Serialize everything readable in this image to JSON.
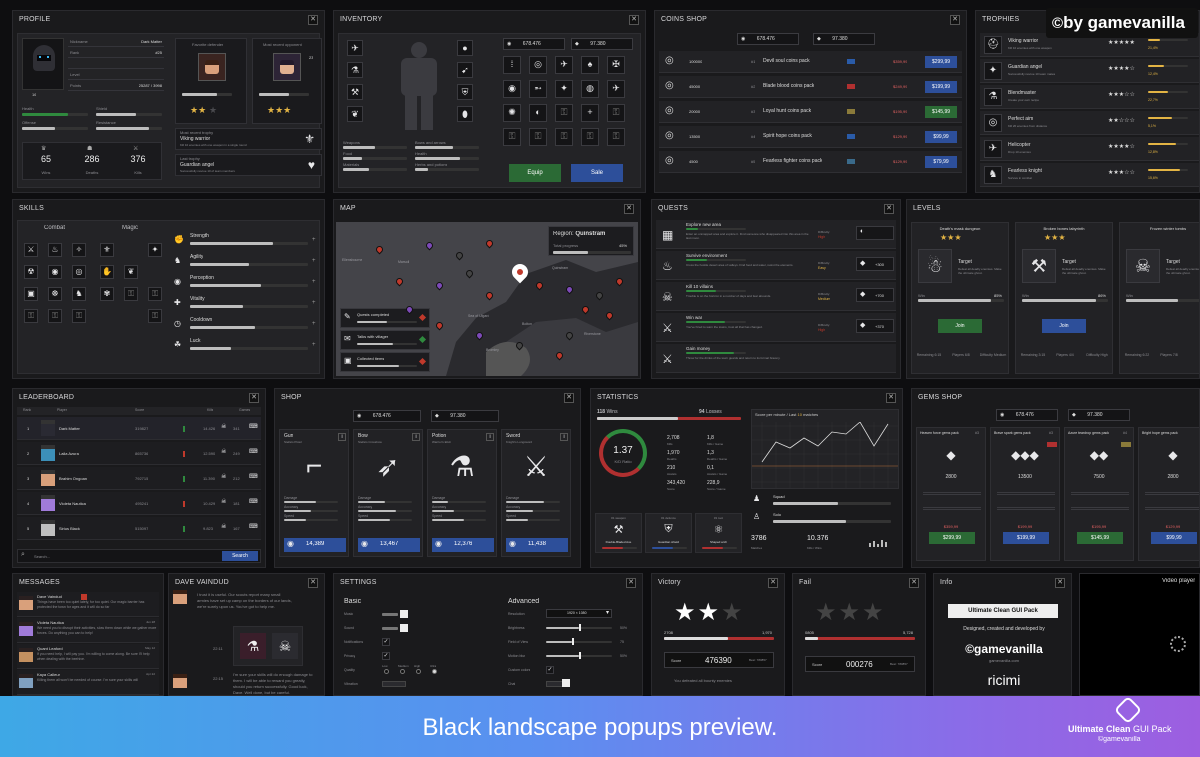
{
  "watermark": "by gamevanilla",
  "banner": {
    "caption": "Black landscape popups preview.",
    "pack_title_a": "Ultimate Clean",
    "pack_title_b": "GUI Pack",
    "copyright": "©gamevanilla"
  },
  "profile": {
    "title": "PROFILE",
    "fields": [
      {
        "k": "Nickname",
        "v": "Dark Matter"
      },
      {
        "k": "Rank",
        "v": "#25"
      },
      {
        "k": "",
        "v": ""
      },
      {
        "k": "Level",
        "v": ""
      },
      {
        "k": "Points",
        "v": "25287 / 3998"
      }
    ],
    "level_badge": "16",
    "stats": [
      {
        "k": "Health"
      },
      {
        "k": "Shield"
      },
      {
        "k": "Offense"
      },
      {
        "k": "Resistance"
      }
    ],
    "counters": [
      {
        "v": "65",
        "k": "Wins"
      },
      {
        "v": "286",
        "k": "Deaths"
      },
      {
        "v": "376",
        "k": "Kills"
      }
    ],
    "fav_label": "Favorite defender",
    "recent_label": "Most recent opponent",
    "recent_level": "23",
    "badges": [
      {
        "sub": "Most recent trophy",
        "name": "Viking warrior",
        "desc": "Kill 10 enemies with one weapon in a single round"
      },
      {
        "sub": "Last trophy",
        "name": "Guardian angel",
        "desc": "Successfully rescue 10 of team members"
      }
    ]
  },
  "inventory": {
    "title": "INVENTORY",
    "coins": "678.476",
    "gems": "97.380",
    "stats": [
      {
        "k": "Weapons"
      },
      {
        "k": "Bows and arrows"
      },
      {
        "k": "Food"
      },
      {
        "k": "Health"
      },
      {
        "k": "Materials"
      },
      {
        "k": "Herbs and potions"
      }
    ],
    "equip": "Equip",
    "sale": "Sale"
  },
  "coins_shop": {
    "title": "COINS SHOP",
    "coins": "678.476",
    "gems": "97.380",
    "items": [
      {
        "qty": "100000",
        "rank": "#1",
        "name": "Devil soul coins pack",
        "tag": "",
        "old": "$359,99",
        "price": "$299,99"
      },
      {
        "qty": "45000",
        "rank": "#2",
        "name": "Blade blood coins pack",
        "tag": "",
        "old": "$249,99",
        "price": "$199,99"
      },
      {
        "qty": "20000",
        "rank": "#3",
        "name": "Loyal hunt coins pack",
        "tag": "",
        "old": "$195,99",
        "price": "$145,99"
      },
      {
        "qty": "13500",
        "rank": "#4",
        "name": "Spirit hope coins pack",
        "tag": "",
        "old": "$129,99",
        "price": "$99,99"
      },
      {
        "qty": "4500",
        "rank": "#5",
        "name": "Fearless fighter coins pack",
        "tag": "",
        "old": "$129,99",
        "price": "$79,99"
      }
    ]
  },
  "trophies": {
    "title": "TROPHIES",
    "items": [
      {
        "name": "Viking warrior",
        "desc": "Kill 10 enemies with one weapon",
        "pct": "21,4%"
      },
      {
        "name": "Guardian angel",
        "desc": "Successfully rescue 10 team mates",
        "pct": "12,4%"
      },
      {
        "name": "Blendmaster",
        "desc": "Create your own recipe",
        "pct": "22,7%"
      },
      {
        "name": "Perfect aim",
        "desc": "Kill 20 enemies from distance",
        "pct": "5,1%"
      },
      {
        "name": "Helicopter",
        "desc": "Drop 10 enemies",
        "pct": "12,8%"
      },
      {
        "name": "Fearless knight",
        "desc": "Survive in combat",
        "pct": "15,6%"
      }
    ]
  },
  "skills": {
    "title": "SKILLS",
    "combat": "Combat",
    "magic": "Magic",
    "bars": [
      {
        "k": "Strength"
      },
      {
        "k": "Agility"
      },
      {
        "k": "Perception"
      },
      {
        "k": "Vitality"
      },
      {
        "k": "Cooldown"
      },
      {
        "k": "Luck"
      }
    ]
  },
  "map": {
    "title": "MAP",
    "region_label": "Region:",
    "region": "Quinstram",
    "progress_label": "Total progress",
    "progress": "45%",
    "places": [
      "Ellensbourne",
      "Marsoll",
      "Quinstram",
      "Bolton",
      "Sea of Ulgard",
      "Bromley",
      "Riverstone"
    ],
    "quests": [
      "Quests completed",
      "Talks with villager",
      "Collected items"
    ]
  },
  "quests": {
    "title": "QUESTS",
    "items": [
      {
        "name": "Explore new area",
        "desc": "Enter an unmapped area and explore it. Find someone who disappeared into this area in the last moon.",
        "diff": "Difficulty:",
        "level": "High",
        "reward": ""
      },
      {
        "name": "Survive environment",
        "desc": "Cross the hostile desert area of valleys. Find food and water, resist the elements.",
        "diff": "Difficulty:",
        "level": "Easy",
        "reward": "+300"
      },
      {
        "name": "Kill 10 villains",
        "desc": "Trouble is on the horizon in a number of days and fear abounds.",
        "diff": "Difficulty:",
        "level": "Medium",
        "reward": "+700"
      },
      {
        "name": "Win war",
        "desc": "You've hired to warn the towns, trust all that has changed.",
        "diff": "Difficulty:",
        "level": "High",
        "reward": "+370"
      },
      {
        "name": "Gain money",
        "desc": "Throw for the drinks of the town guards and return to its formal bravery.",
        "diff": "",
        "level": "",
        "reward": ""
      }
    ]
  },
  "levels": {
    "title": "LEVELS",
    "cards": [
      {
        "name": "Death's mask dungeon",
        "target": "Target",
        "desc": "Defeat all deadly enemies. Make the ultimate ghost.",
        "win": "Win",
        "pct": "85%",
        "btn": "Join",
        "stats": [
          "Remaining 6:15",
          "Players 6/8",
          "Difficulty Medium"
        ]
      },
      {
        "name": "Broken bones labyrinth",
        "target": "Target",
        "desc": "Defeat all deadly enemies. Make the ultimate ghost.",
        "win": "Win",
        "pct": "86%",
        "btn": "Join",
        "stats": [
          "Remaining 3:15",
          "Players 4/4",
          "Difficulty High"
        ]
      },
      {
        "name": "Frozen winter tombs",
        "target": "Target",
        "desc": "Defeat all deadly enemies. Make the ultimate ghost.",
        "win": "Win",
        "pct": "",
        "btn": "",
        "stats": [
          "Remaining 6:22",
          "Players 7/8",
          ""
        ]
      }
    ]
  },
  "leaderboard": {
    "title": "LEADERBOARD",
    "headers": [
      "Rank",
      "Player",
      "Score",
      "Kills",
      "Games"
    ],
    "rows": [
      {
        "rank": "1",
        "name": "Dark Matter",
        "score": "319827",
        "kills": "14.426",
        "games": "341"
      },
      {
        "rank": "2",
        "name": "Laila Azura",
        "score": "865736",
        "kills": "12.590",
        "games": "249"
      },
      {
        "rank": "3",
        "name": "Brahim Ongoan",
        "score": "792715",
        "kills": "11.390",
        "games": "212"
      },
      {
        "rank": "4",
        "name": "Violeta Nautica",
        "score": "495241",
        "kills": "10.429",
        "games": "181"
      },
      {
        "rank": "5",
        "name": "Sirius Black",
        "score": "515097",
        "kills": "9.823",
        "games": "167"
      }
    ],
    "search_placeholder": "Search...",
    "search_btn": "Search"
  },
  "shop": {
    "title": "SHOP",
    "coins": "678.476",
    "gems": "97.380",
    "items": [
      {
        "name": "Gun",
        "sub": "Stella's Pistol",
        "price": "14,389"
      },
      {
        "name": "Bow",
        "sub": "Stella's Crossbow",
        "price": "13,467"
      },
      {
        "name": "Potion",
        "sub": "Warrior's Elixir",
        "price": "12,376"
      },
      {
        "name": "Sword",
        "sub": "Knight's Longsword",
        "price": "11,438"
      }
    ],
    "stat_labels": [
      "Damage",
      "Accuracy",
      "Speed"
    ]
  },
  "statistics": {
    "title": "STATISTICS",
    "wins_label": "Wins",
    "wins": "118",
    "losses_label": "Losses",
    "losses": "94",
    "kd": "1.37",
    "kd_label": "K/D Ratio",
    "grid": [
      {
        "v": "2,708",
        "k": "Kills"
      },
      {
        "v": "1,8",
        "k": "Kills / Game"
      },
      {
        "v": "1,970",
        "k": "Deaths"
      },
      {
        "v": "1,3",
        "k": "Deaths / Game"
      },
      {
        "v": "210",
        "k": "Assists"
      },
      {
        "v": "0,1",
        "k": "Assists / Game"
      },
      {
        "v": "343,420",
        "k": "Score"
      },
      {
        "v": "228,9",
        "k": "Score / Game"
      }
    ],
    "chart_title": "Score per minute / Last",
    "chart_n": "10",
    "chart_suffix": "matches",
    "weapons": [
      {
        "k": "#1 weapon",
        "v": "Double-Bladed Axe"
      },
      {
        "k": "#1 defence",
        "v": "Guardian shield"
      },
      {
        "k": "#1 tool",
        "v": "Shaped arch"
      }
    ],
    "squad": "Squad",
    "solo": "Solo",
    "footer": [
      {
        "v": "3786",
        "k": "Matches"
      },
      {
        "v": "10.376",
        "k": "Kills / Wins"
      }
    ]
  },
  "gems_shop": {
    "title": "GEMS SHOP",
    "coins": "678.476",
    "gems": "97.380",
    "items": [
      {
        "name": "Heaven force gems pack",
        "rank": "#3",
        "qty": "2800",
        "old": "$359,99",
        "price": "$299,99"
      },
      {
        "name": "Brave spark gems pack",
        "rank": "#3",
        "qty": "13500",
        "old": "$199,99",
        "price": "$199,99"
      },
      {
        "name": "Azure teardrop gems pack",
        "rank": "#4",
        "qty": "7500",
        "old": "$195,99",
        "price": "$145,99"
      },
      {
        "name": "Bright hope gems pack",
        "rank": "",
        "qty": "2800",
        "old": "$129,99",
        "price": "$99,99"
      }
    ]
  },
  "messages": {
    "title": "MESSAGES",
    "items": [
      {
        "name": "Dave Vaindud",
        "date": "",
        "text": "Things have been too quiet lately, for too quiet. Our magic barrier has protected the town for ages and it will do so far"
      },
      {
        "name": "Violeta Nautica",
        "date": "Jun 28",
        "text": "We need you to disrupt their activities, slow them down while we gather more forces. Do anything you can to help!"
      },
      {
        "name": "Quant Leaford",
        "date": "May 12",
        "text": "If you need help, I will pay you. I'm willing to come along. Be sure I'll help when dealing with the beehive."
      },
      {
        "name": "Kaya Calleur",
        "date": "Apr 22",
        "text": "Killing them all won't be needed of course. I'm sure your skills will"
      }
    ]
  },
  "chat": {
    "title": "DAVE VAINDUD",
    "msgs": [
      {
        "time": "",
        "text": "I trust it is useful. Our scouts report many small armies have set up camp on the borders of our lands, we're surely upon us. You've got to help me."
      },
      {
        "time": "22:11",
        "text": ""
      },
      {
        "time": "22:15",
        "text": "I'm sure your skills will do enough damage to them. I will be able to reward you greatly, should you return successfully. Good luck, Dave. Well done, but be careful."
      }
    ]
  },
  "settings": {
    "title": "SETTINGS",
    "basic": "Basic",
    "advanced": "Advanced",
    "basic_items": [
      "Music",
      "Sound",
      "Notifications",
      "Privacy",
      "Quality",
      "Vibration"
    ],
    "quality_opts": [
      "Low",
      "Medium",
      "High",
      "Ultra"
    ],
    "adv_items": [
      {
        "k": "Resolution",
        "v": "1920 × 1080"
      },
      {
        "k": "Brightness",
        "v": "50%"
      },
      {
        "k": "Field of View",
        "v": "75"
      },
      {
        "k": "Motion blur",
        "v": "50%"
      },
      {
        "k": "Custom colors",
        "v": ""
      },
      {
        "k": "Chat",
        "v": ""
      }
    ]
  },
  "victory": {
    "title": "Victory",
    "left": "2708",
    "right": "1,970",
    "score_label": "Score",
    "score": "476390",
    "best": "Best: 780857",
    "note": "You defeated all bounty enemies"
  },
  "fail": {
    "title": "Fail",
    "left": "0805",
    "right": "5,728",
    "score_label": "Score",
    "score": "000276",
    "best": "Best: 780857"
  },
  "info": {
    "title": "Info",
    "pack": "Ultimate Clean GUI Pack",
    "by": "Designed, created and developed by",
    "brand": "©gamevanilla",
    "url": "gamevanilla.com",
    "partner": "ricimi"
  },
  "video": {
    "title": "Video player"
  }
}
